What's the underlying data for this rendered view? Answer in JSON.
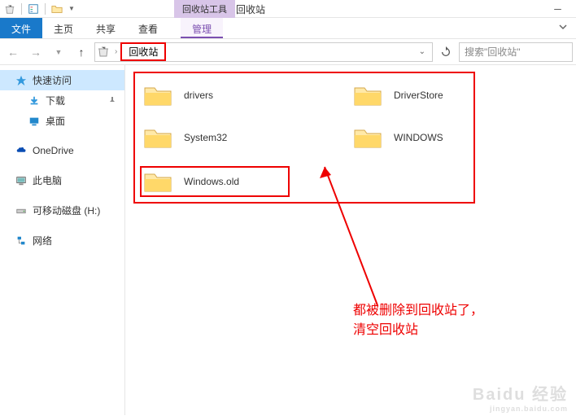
{
  "title_context_tab": "回收站工具",
  "window_title": "回收站",
  "ribbon": {
    "file": "文件",
    "home": "主页",
    "share": "共享",
    "view": "查看",
    "manage": "管理"
  },
  "breadcrumb": {
    "location": "回收站"
  },
  "search": {
    "placeholder": "搜索\"回收站\""
  },
  "sidebar": {
    "quick_access": "快速访问",
    "downloads": "下载",
    "desktop": "桌面",
    "onedrive": "OneDrive",
    "this_pc": "此电脑",
    "removable": "可移动磁盘 (H:)",
    "network": "网络"
  },
  "folders": {
    "drivers": "drivers",
    "driverstore": "DriverStore",
    "system32": "System32",
    "windows": "WINDOWS",
    "windows_old": "Windows.old"
  },
  "annotation": {
    "line1": "都被删除到回收站了，",
    "line2": "清空回收站"
  },
  "watermark": {
    "main": "Baidu 经验",
    "sub": "jingyan.baidu.com"
  },
  "colors": {
    "accent": "#1979ca",
    "highlight": "#e00000"
  }
}
